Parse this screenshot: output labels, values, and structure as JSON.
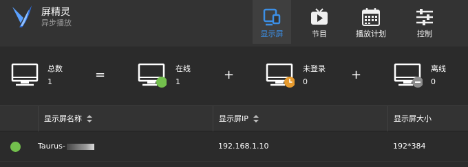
{
  "app": {
    "title": "屏精灵",
    "subtitle": "异步播放",
    "logo": "app-logo"
  },
  "nav": {
    "items": [
      {
        "label": "显示屏",
        "icon": "display-screen-icon",
        "active": true
      },
      {
        "label": "节目",
        "icon": "tv-play-icon",
        "active": false
      },
      {
        "label": "播放计划",
        "icon": "calendar-icon",
        "active": false
      },
      {
        "label": "控制",
        "icon": "sliders-icon",
        "active": false
      }
    ]
  },
  "stats": {
    "total": {
      "label": "总数",
      "value": "1"
    },
    "eq": "=",
    "online": {
      "label": "在线",
      "value": "1",
      "color": "#73c04d"
    },
    "plus1": "+",
    "not_logged_in": {
      "label": "未登录",
      "value": "0",
      "color": "#e69a2e"
    },
    "plus2": "+",
    "offline": {
      "label": "离线",
      "value": "0",
      "color": "#8c8c8c"
    }
  },
  "table": {
    "columns": [
      "显示屏名称",
      "显示屏IP",
      "显示屏大小"
    ],
    "rows": [
      {
        "status": "online",
        "name": "Taurus-",
        "ip": "192.168.1.10",
        "size": "192*384"
      }
    ]
  },
  "colors": {
    "accent": "#3c8fe6",
    "online": "#73c04d",
    "pending": "#e69a2e",
    "offline": "#8c8c8c"
  }
}
